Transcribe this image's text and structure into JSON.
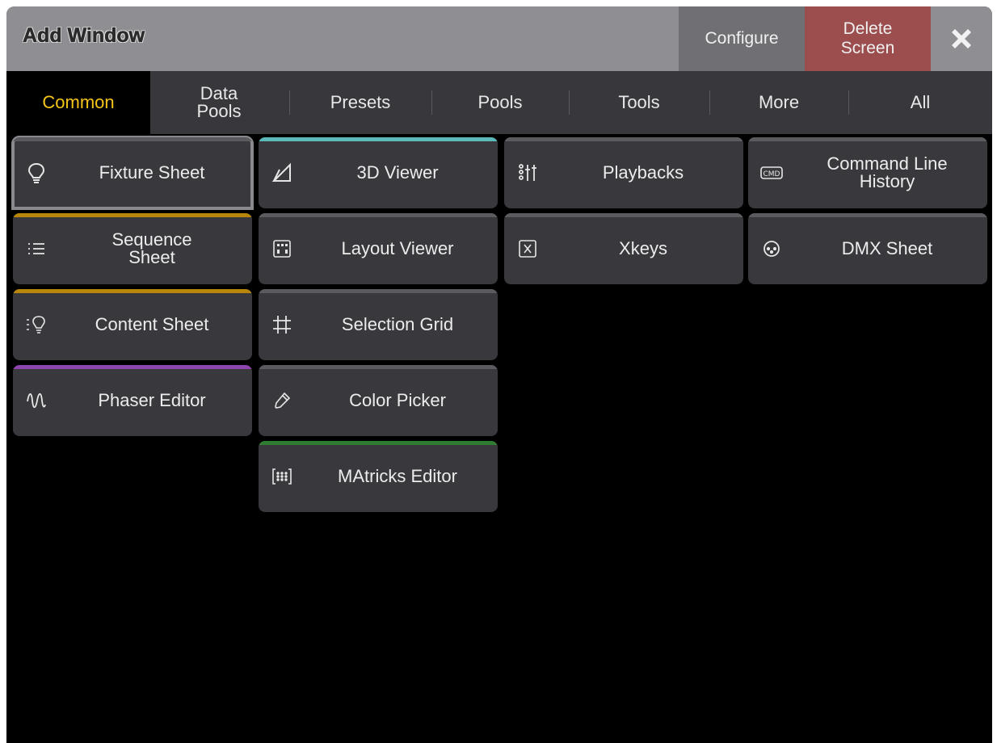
{
  "window": {
    "title": "Add Window",
    "configure_label": "Configure",
    "delete_label_line1": "Delete",
    "delete_label_line2": "Screen",
    "close_icon": "close-icon"
  },
  "tabs": {
    "common": "Common",
    "data_pools_line1": "Data",
    "data_pools_line2": "Pools",
    "presets": "Presets",
    "pools": "Pools",
    "tools": "Tools",
    "more": "More",
    "all": "All"
  },
  "colors": {
    "active_tab_text": "#f5c518",
    "viewer_accent": "#5bbab7",
    "sheet_accent": "#b8860b",
    "phaser_accent": "#8e44ad",
    "matricks_accent": "#2e7d32",
    "default_accent": "#5b5b5f"
  },
  "tiles": {
    "fixture_sheet": {
      "label": "Fixture Sheet",
      "icon": "lightbulb-icon"
    },
    "viewer_3d": {
      "label": "3D Viewer",
      "icon": "3d-plane-icon"
    },
    "playbacks": {
      "label": "Playbacks",
      "icon": "faders-icon"
    },
    "command_line_history_1": "Command Line",
    "command_line_history_2": "History",
    "command_line_history_icon": "cmd-icon",
    "sequence_sheet_1": "Sequence",
    "sequence_sheet_2": "Sheet",
    "sequence_sheet_icon": "list-icon",
    "layout_viewer": {
      "label": "Layout Viewer",
      "icon": "layout-icon"
    },
    "xkeys": {
      "label": "Xkeys",
      "icon": "xkeys-icon"
    },
    "dmx_sheet": {
      "label": "DMX Sheet",
      "icon": "dmx-connector-icon"
    },
    "content_sheet": {
      "label": "Content Sheet",
      "icon": "content-sheet-icon"
    },
    "selection_grid": {
      "label": "Selection Grid",
      "icon": "grid-icon"
    },
    "phaser_editor": {
      "label": "Phaser Editor",
      "icon": "wave-icon"
    },
    "color_picker": {
      "label": "Color Picker",
      "icon": "eyedropper-icon"
    },
    "matricks_editor": {
      "label": "MAtricks Editor",
      "icon": "matricks-icon"
    }
  }
}
